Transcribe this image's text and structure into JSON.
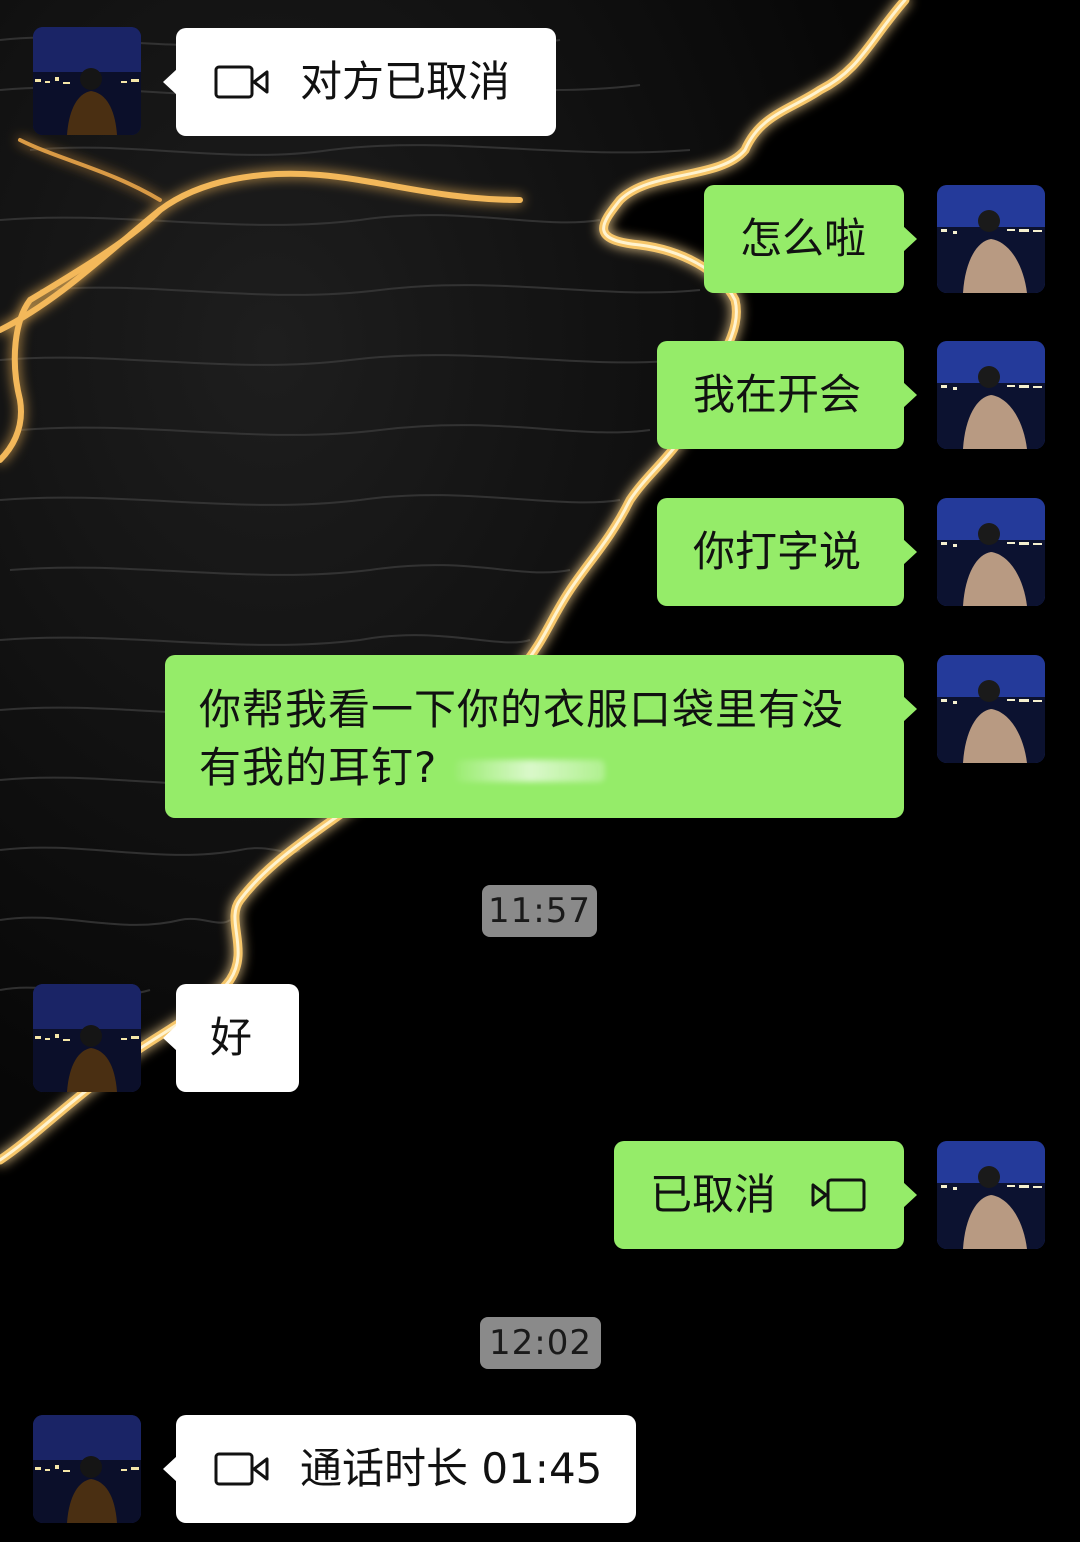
{
  "colors": {
    "incoming_bubble": "#ffffff",
    "outgoing_bubble": "#95ec69",
    "time_pill": "#8a8a8a",
    "background": "#000000"
  },
  "messages": {
    "m1": {
      "text": "对方已取消",
      "icon": "video-camera-icon"
    },
    "m2": {
      "text": "怎么啦"
    },
    "m3": {
      "text": "我在开会"
    },
    "m4": {
      "text": "你打字说"
    },
    "m5": {
      "text": "你帮我看一下你的衣服口袋里有没有我的耳钉?"
    },
    "time1": "11:57",
    "m6": {
      "text": "好"
    },
    "m7": {
      "text": "已取消",
      "icon": "video-camera-icon"
    },
    "time2": "12:02",
    "m8": {
      "text": "通话时长 01:45",
      "icon": "video-camera-icon"
    }
  }
}
